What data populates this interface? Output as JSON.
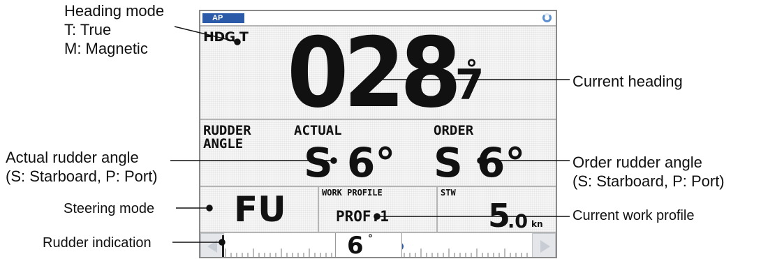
{
  "screen": {
    "ap_badge": "AP",
    "heading": {
      "label": "HDG T",
      "integer": "028",
      "decimal": ".7",
      "degree": "°"
    },
    "rudder": {
      "rudder_label_1": "RUDDER",
      "rudder_label_2": "ANGLE",
      "actual_label": "ACTUAL",
      "order_label": "ORDER",
      "actual_value": "S 6°",
      "order_value": "S 6°"
    },
    "info": {
      "steering_mode": "FU",
      "work_profile_label": "WORK PROFILE",
      "work_profile_value": "PROF.1",
      "stw_label": "STW",
      "stw_integer": "5",
      "stw_decimal": ".0",
      "stw_unit": "kn"
    },
    "rudder_bar": {
      "value": "6",
      "degree": "°",
      "rudder_angle": 6
    }
  },
  "callouts": {
    "heading_mode_1": "Heading mode",
    "heading_mode_2": "T: True",
    "heading_mode_3": "M: Magnetic",
    "current_heading": "Current heading",
    "actual_rudder_1": "Actual rudder angle",
    "actual_rudder_2": "(S: Starboard, P: Port)",
    "order_rudder_1": "Order rudder angle",
    "order_rudder_2": "(S: Starboard, P: Port)",
    "steering_mode": "Steering mode",
    "current_work_profile": "Current work profile",
    "rudder_indication": "Rudder indication"
  },
  "colors": {
    "ap_badge": "#2a5aa8",
    "rudder_fill": "#2e7a3e",
    "order_marker": "#2a5aa8"
  }
}
